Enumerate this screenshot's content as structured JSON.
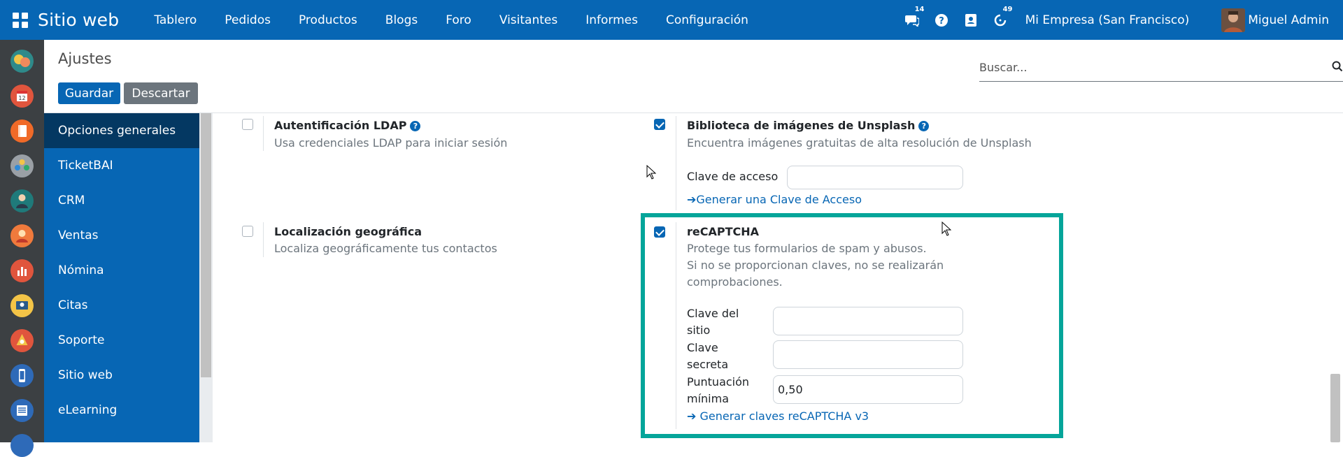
{
  "topbar": {
    "brand": "Sitio web",
    "menu": [
      "Tablero",
      "Pedidos",
      "Productos",
      "Blogs",
      "Foro",
      "Visitantes",
      "Informes",
      "Configuración"
    ],
    "chat_badge": "14",
    "activity_badge": "49",
    "company": "Mi Empresa (San Francisco)",
    "user": "Miguel Admin"
  },
  "control": {
    "breadcrumb": "Ajustes",
    "save_label": "Guardar",
    "discard_label": "Descartar",
    "search_placeholder": "Buscar..."
  },
  "settings_nav": {
    "items": [
      "Opciones generales",
      "TicketBAI",
      "CRM",
      "Ventas",
      "Nómina",
      "Citas",
      "Soporte",
      "Sitio web",
      "eLearning"
    ]
  },
  "settings": {
    "ldap": {
      "title": "Autentificación LDAP",
      "desc": "Usa credenciales LDAP para iniciar sesión",
      "checked": false
    },
    "unsplash": {
      "title": "Biblioteca de imágenes de Unsplash",
      "desc": "Encuentra imágenes gratuitas de alta resolución de Unsplash",
      "checked": true,
      "access_key_label": "Clave de acceso",
      "access_key_value": "",
      "link": "Generar una Clave de Acceso"
    },
    "geo": {
      "title": "Localización geográfica",
      "desc": "Localiza geográficamente tus contactos",
      "checked": false
    },
    "recaptcha": {
      "title": "reCAPTCHA",
      "desc_line1": "Protege tus formularios de spam y abusos.",
      "desc_line2": "Si no se proporcionan claves, no se realizarán",
      "desc_line3": "comprobaciones.",
      "checked": true,
      "site_key_label_1": "Clave del",
      "site_key_label_2": "sitio",
      "site_key_value": "",
      "secret_label_1": "Clave",
      "secret_label_2": "secreta",
      "secret_value": "",
      "score_label_1": "Puntuación",
      "score_label_2": "mínima",
      "score_value": "0,50",
      "link": "Generar claves reCAPTCHA v3"
    }
  },
  "colors": {
    "navbar": "#0766b4",
    "nav_active": "#043862",
    "highlight": "#05a59a"
  }
}
